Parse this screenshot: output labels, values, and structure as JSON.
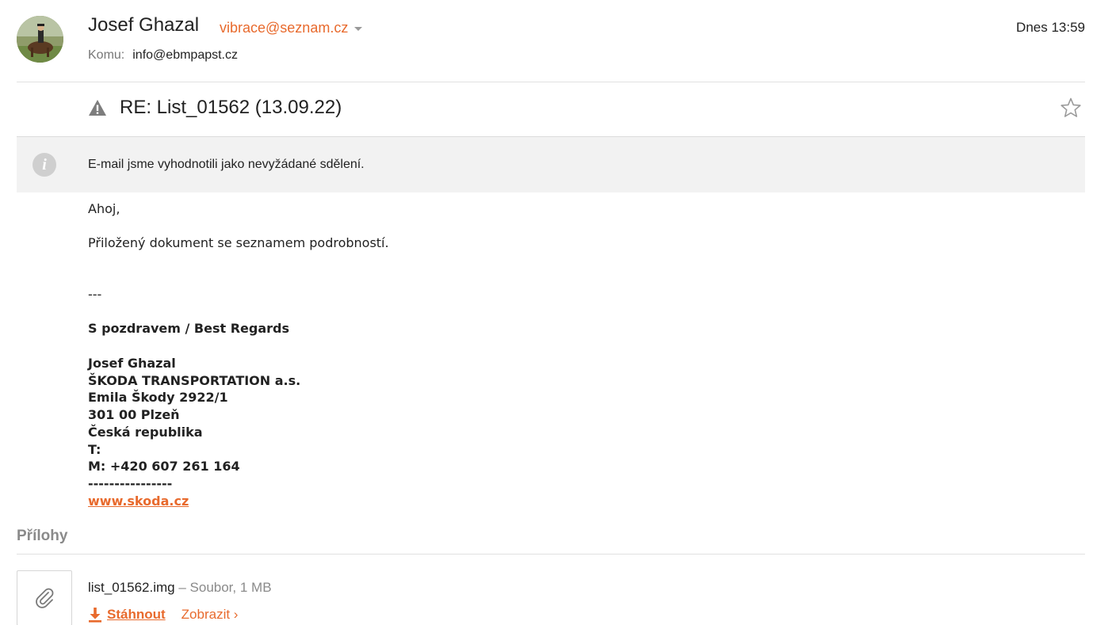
{
  "header": {
    "sender_name": "Josef Ghazal",
    "sender_email": "vibrace@seznam.cz",
    "date": "Dnes 13:59",
    "to_label": "Komu:",
    "to_value": "info@ebmpapst.cz"
  },
  "subject": {
    "text": "RE: List_01562 (13.09.22)",
    "warning_icon": "warning-triangle-icon",
    "star_icon": "star-outline-icon"
  },
  "spam_notice": {
    "text": "E-mail jsme vyhodnotili jako nevyžádané sdělení.",
    "icon": "info-icon"
  },
  "body": {
    "greeting": "Ahoj,",
    "line1": "Přiložený dokument se seznamem podrobností.",
    "separator": "---",
    "regards": "S pozdravem / Best Regards",
    "signature": [
      "Josef Ghazal",
      "ŠKODA TRANSPORTATION a.s.",
      "Emila Škody 2922/1",
      "301 00 Plzeň",
      "Česká republika",
      "T:",
      "M: +420 607 261 164",
      "----------------"
    ],
    "link": "www.skoda.cz"
  },
  "attachments": {
    "title": "Přílohy",
    "file_name": "list_01562.img",
    "file_meta": " – Soubor, 1 MB",
    "download_label": "Stáhnout",
    "view_label": "Zobrazit ›"
  },
  "colors": {
    "accent": "#e86a2d",
    "muted": "#8a8a8a",
    "notice_bg": "#f2f2f2"
  }
}
